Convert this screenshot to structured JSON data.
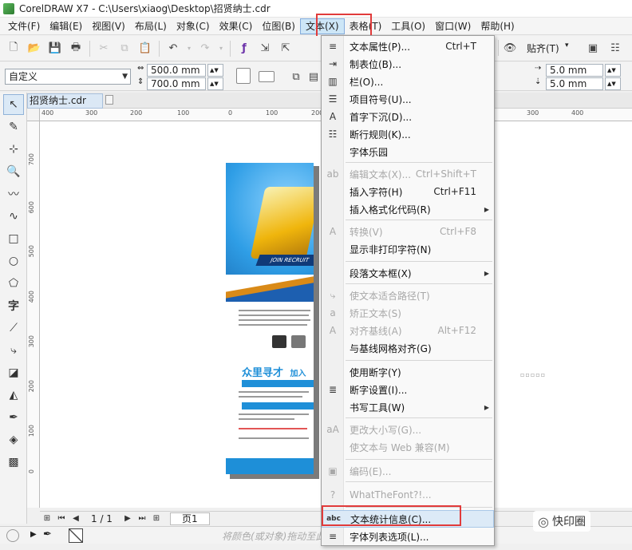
{
  "window": {
    "title": "CorelDRAW X7 - C:\\Users\\xiaog\\Desktop\\招贤纳士.cdr"
  },
  "menubar": [
    {
      "label": "文件(F)"
    },
    {
      "label": "编辑(E)"
    },
    {
      "label": "视图(V)"
    },
    {
      "label": "布局(L)"
    },
    {
      "label": "对象(C)"
    },
    {
      "label": "效果(C)"
    },
    {
      "label": "位图(B)"
    },
    {
      "label": "文本(X)"
    },
    {
      "label": "表格(T)"
    },
    {
      "label": "工具(O)"
    },
    {
      "label": "窗口(W)"
    },
    {
      "label": "帮助(H)"
    }
  ],
  "toolbar": {
    "snap_label": "贴齐(T)",
    "preset_value": "自定义",
    "width_value": "500.0 mm",
    "height_value": "700.0 mm",
    "nudge_x_value": "5.0 mm",
    "nudge_y_value": "5.0 mm"
  },
  "doc_tab": {
    "label": "招贤纳士.cdr"
  },
  "ruler_h": [
    "400",
    "300",
    "200",
    "100",
    "0",
    "100",
    "200",
    "300",
    "400"
  ],
  "ruler_v": [
    "700",
    "600",
    "500",
    "400",
    "300",
    "200",
    "100",
    "0"
  ],
  "poster": {
    "headline": "众里寻才",
    "headline_sub": "加入",
    "join_text": "JOIN RECRUIT"
  },
  "page_nav": {
    "count": "1 / 1",
    "page_tab": "页1"
  },
  "status": {
    "hint": "将颜色(或对象)拖动至此"
  },
  "watermark": {
    "text": "快印圈"
  },
  "dropdown": {
    "items": [
      {
        "icon": "≡",
        "label": "文本属性(P)...",
        "shortcut": "Ctrl+T",
        "disabled": false
      },
      {
        "icon": "⇥",
        "label": "制表位(B)...",
        "shortcut": "",
        "disabled": false
      },
      {
        "icon": "▥",
        "label": "栏(O)...",
        "shortcut": "",
        "disabled": false
      },
      {
        "icon": "☰",
        "label": "项目符号(U)...",
        "shortcut": "",
        "disabled": false
      },
      {
        "icon": "A",
        "label": "首字下沉(D)...",
        "shortcut": "",
        "disabled": false
      },
      {
        "icon": "☷",
        "label": "断行规则(K)...",
        "shortcut": "",
        "disabled": false
      },
      {
        "icon": "",
        "label": "字体乐园",
        "shortcut": "",
        "disabled": false
      },
      {
        "icon": "ab",
        "label": "编辑文本(X)...",
        "shortcut": "Ctrl+Shift+T",
        "disabled": true
      },
      {
        "icon": "",
        "label": "插入字符(H)",
        "shortcut": "Ctrl+F11",
        "disabled": false
      },
      {
        "icon": "",
        "label": "插入格式化代码(R)",
        "shortcut": "",
        "disabled": false,
        "submenu": true
      },
      {
        "icon": "A",
        "label": "转换(V)",
        "shortcut": "Ctrl+F8",
        "disabled": true
      },
      {
        "icon": "",
        "label": "显示非打印字符(N)",
        "shortcut": "",
        "disabled": false
      },
      {
        "icon": "",
        "label": "段落文本框(X)",
        "shortcut": "",
        "disabled": false,
        "submenu": true
      },
      {
        "icon": "⤷",
        "label": "使文本适合路径(T)",
        "shortcut": "",
        "disabled": true
      },
      {
        "icon": "a",
        "label": "矫正文本(S)",
        "shortcut": "",
        "disabled": true
      },
      {
        "icon": "A",
        "label": "对齐基线(A)",
        "shortcut": "Alt+F12",
        "disabled": true
      },
      {
        "icon": "",
        "label": "与基线网格对齐(G)",
        "shortcut": "",
        "disabled": false
      },
      {
        "icon": "",
        "label": "使用断字(Y)",
        "shortcut": "",
        "disabled": false
      },
      {
        "icon": "≣",
        "label": "断字设置(I)...",
        "shortcut": "",
        "disabled": false
      },
      {
        "icon": "",
        "label": "书写工具(W)",
        "shortcut": "",
        "disabled": false,
        "submenu": true
      },
      {
        "icon": "aA",
        "label": "更改大小写(G)...",
        "shortcut": "",
        "disabled": true
      },
      {
        "icon": "",
        "label": "使文本与 Web 兼容(M)",
        "shortcut": "",
        "disabled": true
      },
      {
        "icon": "▣",
        "label": "编码(E)...",
        "shortcut": "",
        "disabled": true
      },
      {
        "icon": "?",
        "label": "WhatTheFont?!...",
        "shortcut": "",
        "disabled": true
      },
      {
        "icon": "abc",
        "label": "文本统计信息(C)...",
        "shortcut": "",
        "disabled": false,
        "selected": true
      },
      {
        "icon": "≡",
        "label": "字体列表选项(L)...",
        "shortcut": "",
        "disabled": false
      }
    ]
  }
}
